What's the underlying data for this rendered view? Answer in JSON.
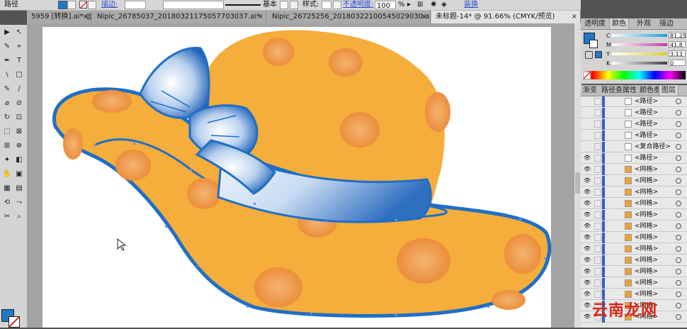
{
  "control_bar": {
    "path_label": "路径",
    "stroke_label": "描边:",
    "stroke_style": "基本",
    "style_label": "样式:",
    "opacity_label": "不透明度:",
    "opacity_value": "100",
    "opacity_unit": "%",
    "recolor_label": "装换",
    "fill_color": "#1f78c8"
  },
  "document_tabs": [
    {
      "label": "5959 [转换].ai* @ ...",
      "close": "×"
    },
    {
      "label": "Nipic_26785037_20180321175057703037.ai*",
      "close": "×"
    },
    {
      "label": "Nipic_26725256_20180322100545029030.ai*",
      "close": "×"
    },
    {
      "label": "未标题-14* @ 91.66% (CMYK/预览)",
      "close": "×"
    }
  ],
  "toolbar": {
    "tools": [
      "▶",
      "↖",
      "✎",
      "⌖",
      "✒",
      "T",
      "\\",
      "□",
      "✎",
      "/",
      "⌀",
      "⊘",
      "↻",
      "⊡",
      "⬚",
      "⊠",
      "⊞",
      "⊕",
      "✦",
      "◧",
      "✋",
      "▣",
      "▦",
      "▤",
      "⟲",
      "⤳",
      "✂",
      "⌕"
    ]
  },
  "color_panel": {
    "tabs": [
      "透明度",
      "颜色",
      "外观",
      "描边"
    ],
    "sliders": [
      {
        "label": "C",
        "value": "81.25",
        "color": "#1aa0d8"
      },
      {
        "label": "M",
        "value": "41.8",
        "color": "#c23ca0"
      },
      {
        "label": "Y",
        "value": "3.13",
        "color": "#d8d020"
      },
      {
        "label": "K",
        "value": "0",
        "color": "#404040"
      }
    ],
    "fill_swatch": "#1f78c8"
  },
  "layers_panel": {
    "tabs": [
      "渐变",
      "路径查",
      "属性",
      "颜色参",
      "图层"
    ],
    "rows": [
      {
        "name": "<路径>",
        "eye": "",
        "thumb": "#ffffff"
      },
      {
        "name": "<路径>",
        "eye": "",
        "thumb": "#ffffff"
      },
      {
        "name": "<路径>",
        "eye": "",
        "thumb": "#ffffff"
      },
      {
        "name": "<路径>",
        "eye": "",
        "thumb": "#ffffff"
      },
      {
        "name": "<复合路径>",
        "eye": "",
        "thumb": "#ffffff"
      },
      {
        "name": "<路径>",
        "eye": "👁",
        "thumb": "#ffffff"
      },
      {
        "name": "<网格>",
        "eye": "👁",
        "thumb": "#f0a030"
      },
      {
        "name": "<网格>",
        "eye": "👁",
        "thumb": "#f0a030"
      },
      {
        "name": "<网格>",
        "eye": "👁",
        "thumb": "#f0a030"
      },
      {
        "name": "<网格>",
        "eye": "👁",
        "thumb": "#f0a030"
      },
      {
        "name": "<网格>",
        "eye": "👁",
        "thumb": "#f0a030"
      },
      {
        "name": "<网格>",
        "eye": "👁",
        "thumb": "#f0a030"
      },
      {
        "name": "<网格>",
        "eye": "👁",
        "thumb": "#f0a030"
      },
      {
        "name": "<网格>",
        "eye": "👁",
        "thumb": "#f0a030"
      },
      {
        "name": "<网格>",
        "eye": "👁",
        "thumb": "#f0a030"
      },
      {
        "name": "<网格>",
        "eye": "👁",
        "thumb": "#f0a030"
      },
      {
        "name": "<网格>",
        "eye": "👁",
        "thumb": "#f0a030"
      },
      {
        "name": "<网格>",
        "eye": "👁",
        "thumb": "#f0a030"
      },
      {
        "name": "<网格>",
        "eye": "👁",
        "thumb": "#f0a030"
      },
      {
        "name": "<网格>",
        "eye": "👁",
        "thumb": "#f0a030"
      }
    ]
  },
  "watermark": "云南龙网",
  "colors": {
    "hat_fill": "#f5ad3b",
    "hat_spot": "#ef9a45",
    "outline": "#1f6fc6",
    "ribbon_light": "#eef4fb",
    "ribbon_dark": "#2f6fc0"
  }
}
